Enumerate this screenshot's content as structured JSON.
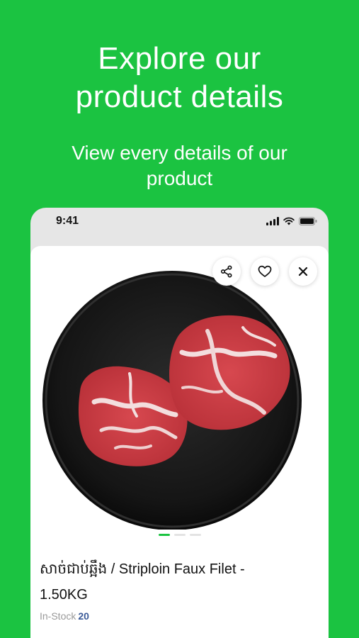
{
  "promo": {
    "headline_line1": "Explore our",
    "headline_line2": "product details",
    "sub_line1": "View every details of our",
    "sub_line2": "product"
  },
  "status_bar": {
    "time": "9:41",
    "icons": [
      "signal-icon",
      "wifi-icon",
      "battery-icon"
    ]
  },
  "product": {
    "title_line1": "សាច់ជាប់ឆ្អឹង / Striploin Faux Filet -",
    "title_line2": "1.50KG",
    "stock_label": "In-Stock",
    "stock_count": "20",
    "image_pages": 3,
    "active_page": 1
  },
  "actions": [
    "share-icon",
    "heart-icon",
    "close-icon"
  ],
  "colors": {
    "brand_green": "#1bc341",
    "stock_count": "#3a5a98"
  }
}
